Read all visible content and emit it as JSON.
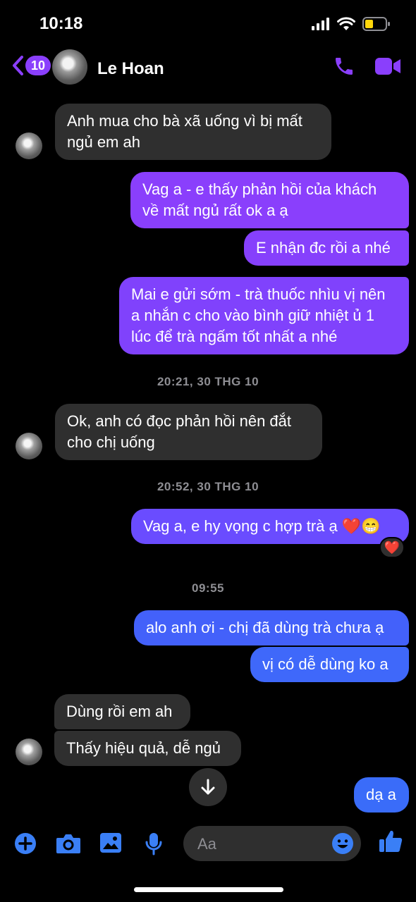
{
  "status_bar": {
    "time": "10:18"
  },
  "header": {
    "back_count": "10",
    "contact_name": "Le Hoan"
  },
  "conversation": {
    "messages": [
      {
        "text": "Anh mua cho bà xã uống vì bị mất ngủ em ah"
      },
      {
        "text": "Vag a - e thấy phản hồi của khách về mất ngủ rất ok a ạ"
      },
      {
        "text": "E nhận đc rồi a nhé"
      },
      {
        "text": "Mai e gửi sớm - trà thuốc nhìu vị nên a nhắn c cho vào bình giữ nhiệt ủ 1 lúc để trà ngấm tốt nhất a nhé"
      },
      {
        "text": "Ok, anh có đọc phản hồi nên đắt cho chị uống"
      },
      {
        "text": "Vag a, e hy vọng c hợp trà ạ ❤️😁"
      },
      {
        "text": "alo anh ơi - chị đã dùng trà chưa ạ"
      },
      {
        "text": "vị có dễ dùng ko a"
      },
      {
        "text": "Dùng rồi em ah"
      },
      {
        "text": "Thấy hiệu quả, dễ ngủ"
      },
      {
        "text": "dạ a"
      }
    ],
    "timestamps": [
      "20:21, 30 THG 10",
      "20:52, 30 THG 10",
      "09:55"
    ],
    "reaction": "❤️"
  },
  "composer": {
    "placeholder": "Aa"
  },
  "colors": {
    "accent": "#8a3ffc",
    "incoming_bubble": "#2f2f2f",
    "outgoing_top": "#8a3ffc",
    "outgoing_mid": "#6a4cff",
    "outgoing_bottom": "#3f68fa",
    "composer_icon": "#3a7ff6"
  },
  "icons": {
    "back": "chevron-left-icon",
    "call": "phone-icon",
    "video": "video-camera-icon",
    "add": "plus-circle-icon",
    "camera": "camera-icon",
    "gallery": "image-icon",
    "mic": "microphone-icon",
    "emoji": "smiley-icon",
    "like": "thumbs-up-icon",
    "scroll": "arrow-down-icon"
  }
}
